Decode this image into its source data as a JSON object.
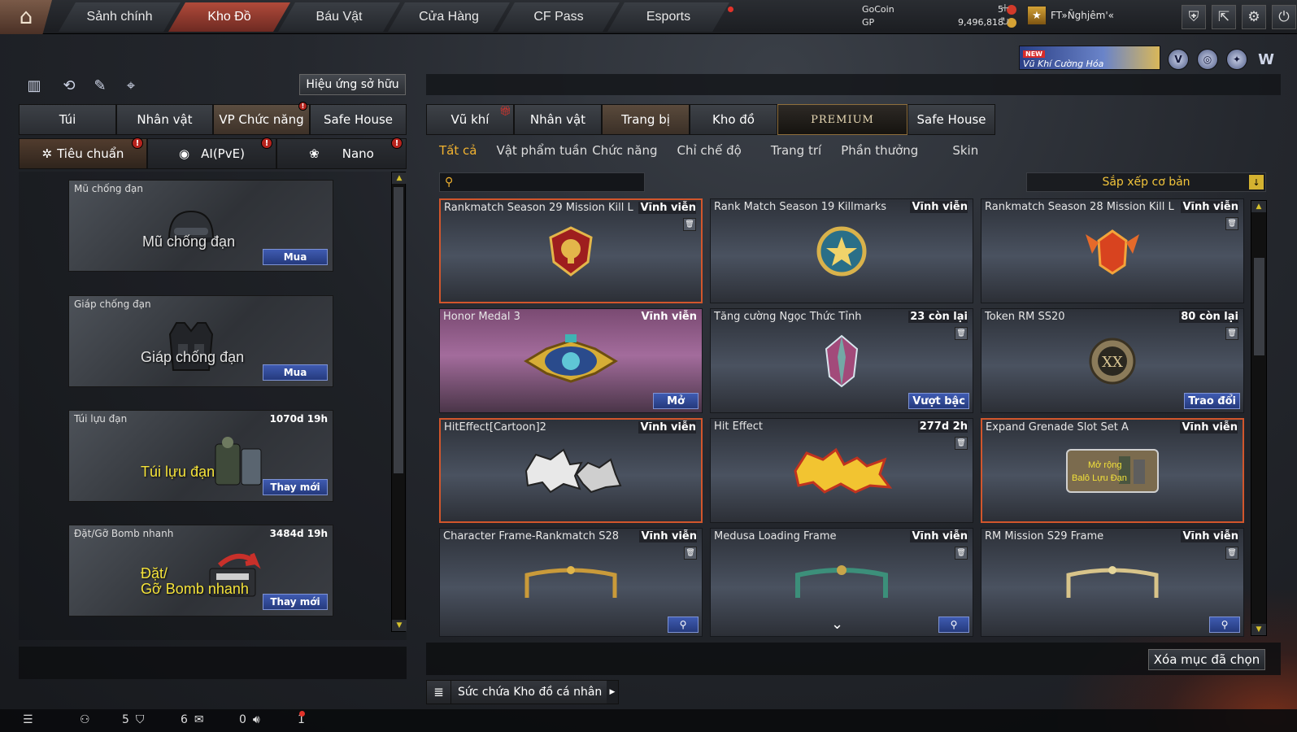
{
  "top_nav": {
    "tabs": [
      "Sảnh chính",
      "Kho Đồ",
      "Báu Vật",
      "Cửa Hàng",
      "CF Pass",
      "Esports"
    ],
    "active_tab": "Kho Đồ",
    "currency": {
      "gocoin_label": "GoCoin",
      "gocoin_value": "5",
      "gp_label": "GP",
      "gp_value": "9,496,818"
    },
    "username": "FT»Ñghjêm'«",
    "icons": [
      "shield-icon",
      "exit-arrow-icon",
      "gear-icon",
      "power-icon"
    ]
  },
  "promo": {
    "new_badge": "NEW",
    "text": "Vũ Khí Cường Hóa"
  },
  "left_panel": {
    "effect_button": "Hiệu ứng sở hữu",
    "tabs": [
      "Túi",
      "Nhân vật",
      "VP Chức năng",
      "Safe House"
    ],
    "active_tab": "VP Chức năng",
    "sub_tabs": [
      "Tiêu chuẩn",
      "AI(PvE)",
      "Nano"
    ],
    "active_sub_tab": "Tiêu chuẩn",
    "items": [
      {
        "name": "Mũ chống đạn",
        "duration": "",
        "art_text": "Mũ chống đạn",
        "action": "Mua",
        "icon": "helmet-icon"
      },
      {
        "name": "Giáp chống đạn",
        "duration": "",
        "art_text": "Giáp chống đạn",
        "action": "Mua",
        "icon": "vest-icon"
      },
      {
        "name": "Túi lựu đạn",
        "duration": "1070d 19h",
        "art_text": "Túi lựu đạn",
        "action": "Thay mới",
        "icon": "grenade-pouch-icon"
      },
      {
        "name": "Đặt/Gỡ Bomb nhanh",
        "duration": "3484d 19h",
        "art_text": "Đặt/\nGỡ Bomb nhanh",
        "action": "Thay mới",
        "icon": "bomb-kit-icon"
      }
    ]
  },
  "right_panel": {
    "tabs": [
      "Vũ khí",
      "Nhân vật",
      "Trang bị",
      "Kho đồ",
      "PREMIUM",
      "Safe House"
    ],
    "active_tab": "Trang bị",
    "filters": [
      "Tất cả",
      "Vật phẩm tuần",
      "Chức năng",
      "Chỉ chế độ",
      "Trang trí",
      "Phần thưởng",
      "Skin"
    ],
    "active_filter": "Tất cả",
    "search_placeholder": "",
    "sort_label": "Sắp xếp cơ bản",
    "items": [
      {
        "name": "Rankmatch Season 29 Mission Kill L",
        "duration": "Vĩnh viễn",
        "button": "",
        "icon": "trophy-medal-icon"
      },
      {
        "name": "Rank Match Season 19 Killmarks",
        "duration": "Vĩnh viễn",
        "button": "",
        "icon": "star-trophy-icon"
      },
      {
        "name": "Rankmatch Season 28 Mission Kill L",
        "duration": "Vĩnh viễn",
        "button": "",
        "icon": "winged-emblem-icon"
      },
      {
        "name": "Honor Medal 3",
        "duration": "Vĩnh viễn",
        "button": "Mở",
        "icon": "honor-medal-icon"
      },
      {
        "name": "Tăng cường Ngọc Thức Tỉnh",
        "duration": "23 còn lại",
        "button": "Vượt bậc",
        "icon": "crystal-gem-icon"
      },
      {
        "name": "Token RM SS20",
        "duration": "80 còn lại",
        "button": "Trao đổi",
        "icon": "token-coin-icon"
      },
      {
        "name": "HitEffect[Cartoon]2",
        "duration": "Vĩnh viễn",
        "button": "",
        "icon": "bam-effect-icon"
      },
      {
        "name": "Hit Effect",
        "duration": "277d 2h",
        "button": "",
        "icon": "bam-whoa-effect-icon"
      },
      {
        "name": "Expand Grenade Slot Set A",
        "duration": "Vĩnh viễn",
        "button": "",
        "icon": "grenade-slot-icon"
      },
      {
        "name": "Character Frame-Rankmatch S28",
        "duration": "Vĩnh viễn",
        "button": "",
        "icon": "gold-frame-icon"
      },
      {
        "name": "Medusa Loading Frame",
        "duration": "Vĩnh viễn",
        "button": "",
        "icon": "medusa-frame-icon"
      },
      {
        "name": "RM Mission S29 Frame",
        "duration": "Vĩnh viễn",
        "button": "",
        "icon": "silver-frame-icon"
      }
    ],
    "delete_button": "Xóa mục đã chọn",
    "capacity_label": "Sức chứa Kho đồ cá nhân"
  },
  "status_bar": {
    "friends_count": "5",
    "clan_count": "6",
    "messages_count": "0",
    "volume_count": "1"
  }
}
